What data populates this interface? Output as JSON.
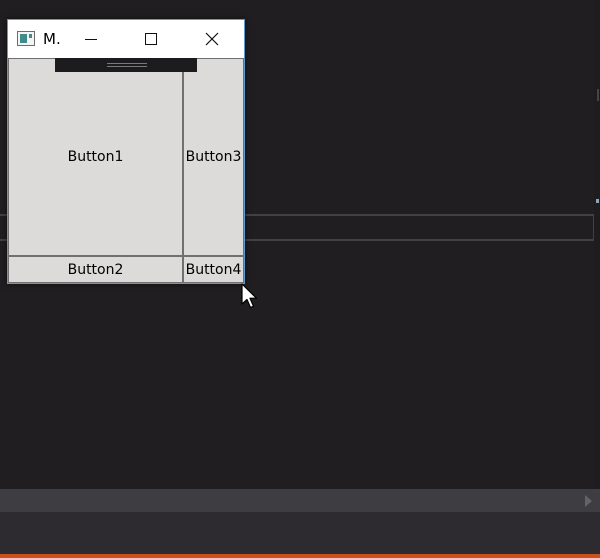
{
  "window": {
    "title": "M.",
    "accent_border": "#5d9bcf"
  },
  "caption_buttons": {
    "minimize": "minimize-icon",
    "maximize": "maximize-icon",
    "close": "close-icon"
  },
  "buttons": {
    "button1": "Button1",
    "button2": "Button2",
    "button3": "Button3",
    "button4": "Button4"
  },
  "colors": {
    "desktop_background": "#201e21",
    "client_background": "#dcdad9",
    "status_bar": "#c9521b"
  }
}
